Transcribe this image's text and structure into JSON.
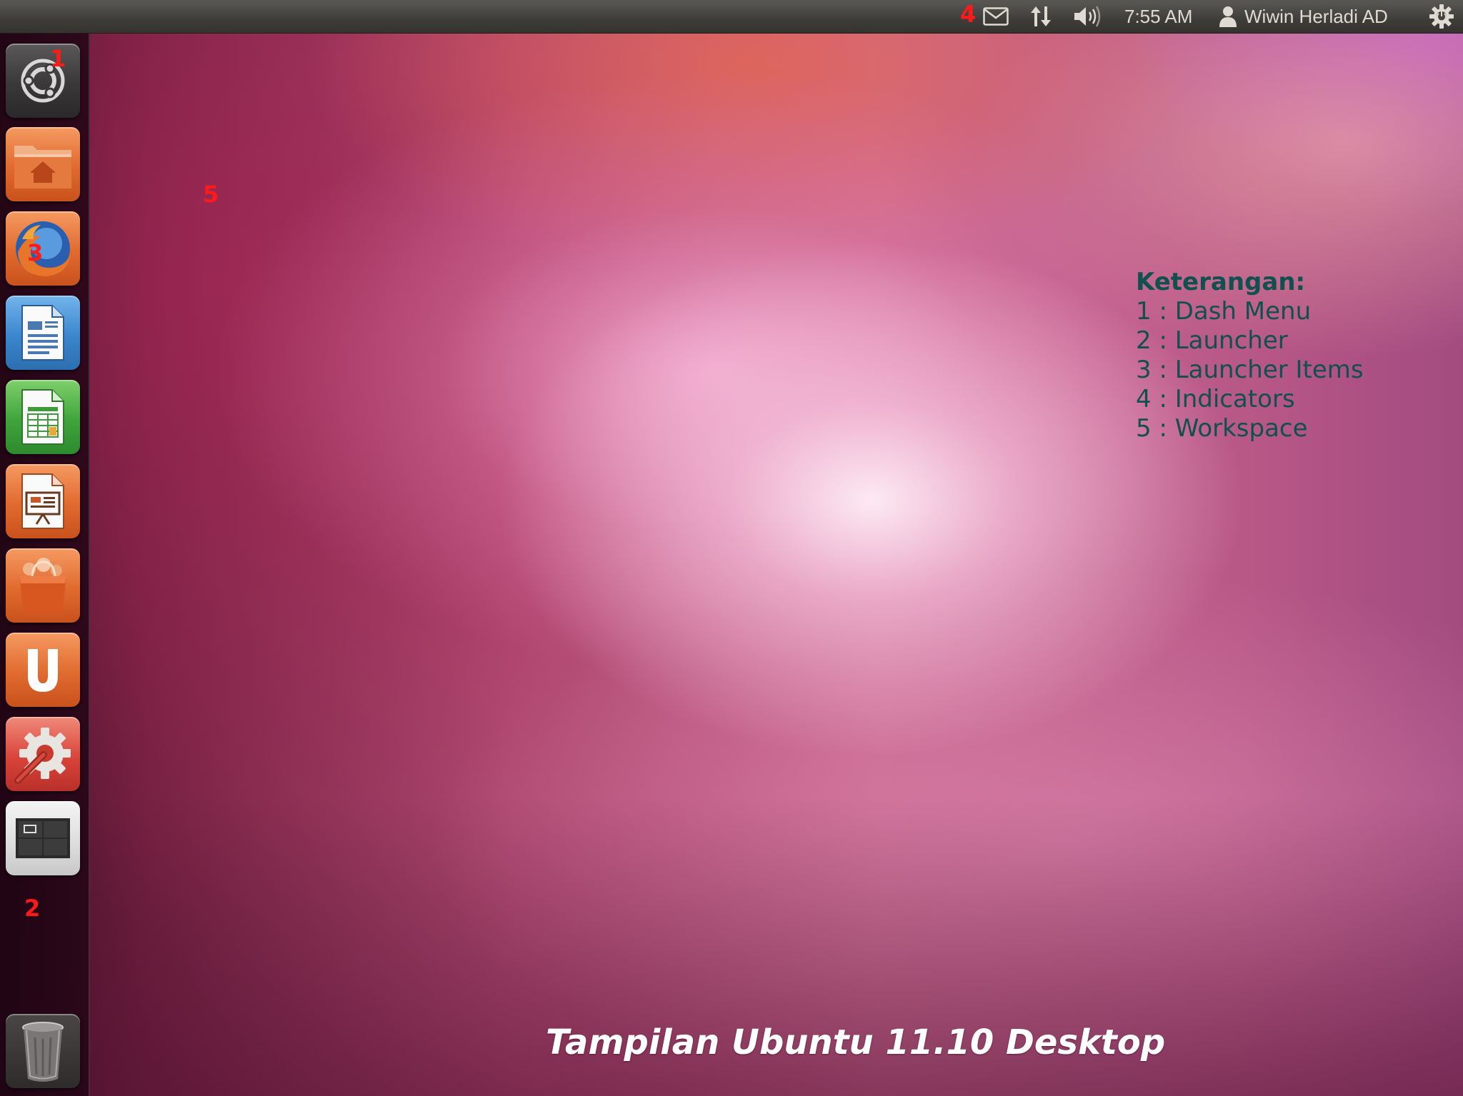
{
  "top_panel": {
    "indicators": {
      "mail_icon": "envelope-icon",
      "network_icon": "network-updown-icon",
      "sound_icon": "speaker-icon",
      "clock": "7:55 AM",
      "user_icon": "person-icon",
      "user_name": "Wiwin Herladi AD",
      "session_icon": "gear-power-icon"
    }
  },
  "launcher": {
    "items": [
      {
        "name": "Dash",
        "icon": "ubuntu-logo-icon"
      },
      {
        "name": "Home Folder",
        "icon": "home-folder-icon"
      },
      {
        "name": "Firefox",
        "icon": "firefox-icon"
      },
      {
        "name": "LibreOffice Writer",
        "icon": "writer-document-icon"
      },
      {
        "name": "LibreOffice Calc",
        "icon": "calc-spreadsheet-icon"
      },
      {
        "name": "LibreOffice Impress",
        "icon": "impress-presentation-icon"
      },
      {
        "name": "Ubuntu Software Center",
        "icon": "software-center-bag-icon"
      },
      {
        "name": "Ubuntu One",
        "icon": "ubuntu-one-icon"
      },
      {
        "name": "System Settings",
        "icon": "settings-wrench-icon"
      },
      {
        "name": "Workspace Switcher",
        "icon": "workspace-switcher-icon"
      },
      {
        "name": "Trash",
        "icon": "trash-icon"
      }
    ]
  },
  "annotations": {
    "n1": "1",
    "n2": "2",
    "n3": "3",
    "n4": "4",
    "n5": "5"
  },
  "legend": {
    "title": "Keterangan:",
    "items": [
      "1 : Dash Menu",
      "2 : Launcher",
      "3 : Launcher Items",
      "4 : Indicators",
      "5 : Workspace"
    ]
  },
  "caption": "Tampilan Ubuntu 11.10 Desktop",
  "colors": {
    "annotation_red": "#ff1a1a",
    "legend_teal": "#10504e",
    "panel_dark": "#3f3d39",
    "ubuntu_orange": "#e06a2e"
  }
}
